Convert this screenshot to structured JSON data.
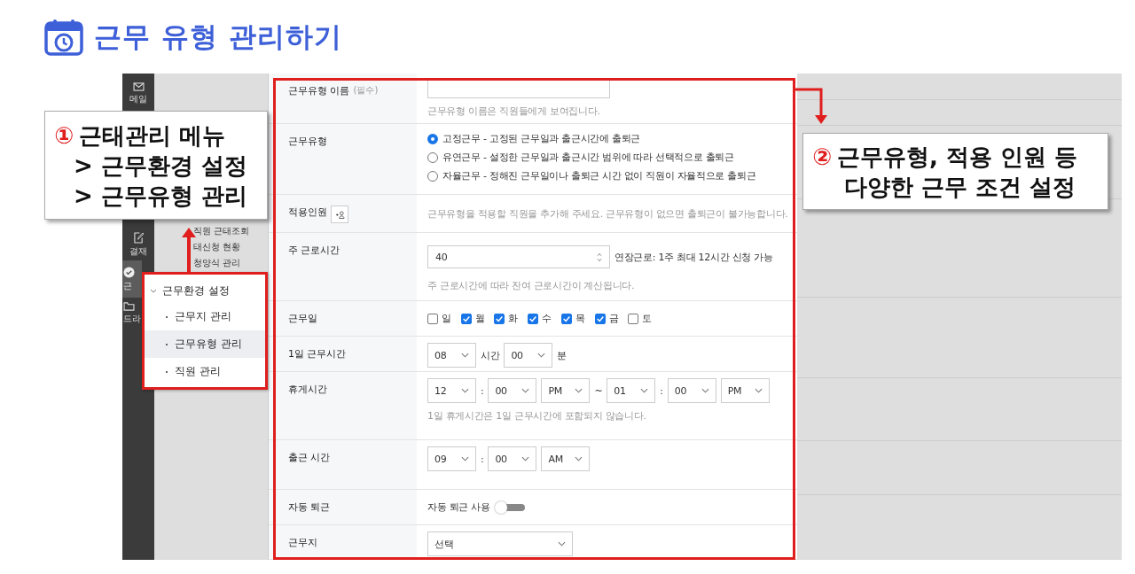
{
  "title": "근무 유형 관리하기",
  "app": {
    "sidebar": [
      {
        "kind": "mail",
        "label": "메일",
        "selected": false
      },
      {
        "kind": "edit",
        "label": "결재",
        "selected": false
      },
      {
        "kind": "check",
        "label": "근",
        "selected": true
      },
      {
        "kind": "folder",
        "label": "드라",
        "selected": false
      }
    ],
    "subnav": [
      "직원 근태조회",
      "태신청 현황",
      "청양식 관리"
    ],
    "form": {
      "rows": [
        {
          "kind": "text",
          "label": "근무유형 이름",
          "note": "(필수)",
          "hint": "근무유형 이름은 직원들에게 보여집니다."
        },
        {
          "kind": "radio",
          "label": "근무유형",
          "options": [
            {
              "label": "고정근무 - 고정된 근무일과 출근시간에 출퇴근",
              "selected": true
            },
            {
              "label": "유연근무 - 설정한 근무일과 출근시간 범위에 따라 선택적으로 출퇴근",
              "selected": false
            },
            {
              "label": "자율근무 - 정해진 근무일이나 출퇴근 시간 없이 직원이 자율적으로 출퇴근",
              "selected": false
            }
          ]
        },
        {
          "kind": "people",
          "label": "적용인원",
          "hint": "근무유형을 적용할 직원을 추가해 주세요. 근무유형이 없으면 출퇴근이 불가능합니다."
        },
        {
          "kind": "number",
          "label": "주 근로시간",
          "value": "40",
          "aside": "연장근로: 1주 최대 12시간 신청 가능",
          "hint": "주 근로시간에 따라 잔여 근로시간이 계산됩니다."
        },
        {
          "kind": "days",
          "label": "근무일",
          "days": [
            {
              "label": "일",
              "checked": false
            },
            {
              "label": "월",
              "checked": true
            },
            {
              "label": "화",
              "checked": true
            },
            {
              "label": "수",
              "checked": true
            },
            {
              "label": "목",
              "checked": true
            },
            {
              "label": "금",
              "checked": true
            },
            {
              "label": "토",
              "checked": false
            }
          ]
        },
        {
          "kind": "parts",
          "label": "1일 근무시간",
          "parts": [
            {
              "kind": "select",
              "text": "08"
            },
            {
              "kind": "text",
              "text": "시간"
            },
            {
              "kind": "select",
              "text": "00"
            },
            {
              "kind": "text",
              "text": "분"
            }
          ]
        },
        {
          "kind": "parts",
          "label": "휴게시간",
          "parts": [
            {
              "kind": "select",
              "text": "12"
            },
            {
              "kind": "sep",
              "text": ":"
            },
            {
              "kind": "select",
              "text": "00"
            },
            {
              "kind": "select",
              "text": "PM"
            },
            {
              "kind": "sep",
              "text": "~"
            },
            {
              "kind": "select",
              "text": "01"
            },
            {
              "kind": "sep",
              "text": ":"
            },
            {
              "kind": "select",
              "text": "00"
            },
            {
              "kind": "select",
              "text": "PM"
            }
          ],
          "hint": "1일 휴게시간은 1일 근무시간에 포함되지 않습니다."
        },
        {
          "kind": "parts",
          "label": "출근 시간",
          "parts": [
            {
              "kind": "select",
              "text": "09"
            },
            {
              "kind": "sep",
              "text": ":"
            },
            {
              "kind": "select",
              "text": "00"
            },
            {
              "kind": "select",
              "text": "AM"
            }
          ]
        },
        {
          "kind": "toggle",
          "label": "자동 퇴근",
          "text": "자동 퇴근 사용",
          "on": false
        },
        {
          "kind": "parts",
          "label": "근무지",
          "parts": [
            {
              "kind": "wide-select",
              "text": "선택"
            }
          ]
        }
      ]
    }
  },
  "menu_popup": {
    "header": "근무환경 설정",
    "expanded": true,
    "items": [
      {
        "label": "근무지 관리",
        "selected": false
      },
      {
        "label": "근무유형 관리",
        "selected": true
      },
      {
        "label": "직원 관리",
        "selected": false
      }
    ]
  },
  "callouts": [
    {
      "number": "①",
      "lines": [
        "근태관리 메뉴",
        "> 근무환경 설정",
        "> 근무유형 관리"
      ]
    },
    {
      "number": "②",
      "lines": [
        "근무유형, 적용 인원 등",
        "다양한 근무 조건 설정"
      ]
    }
  ]
}
